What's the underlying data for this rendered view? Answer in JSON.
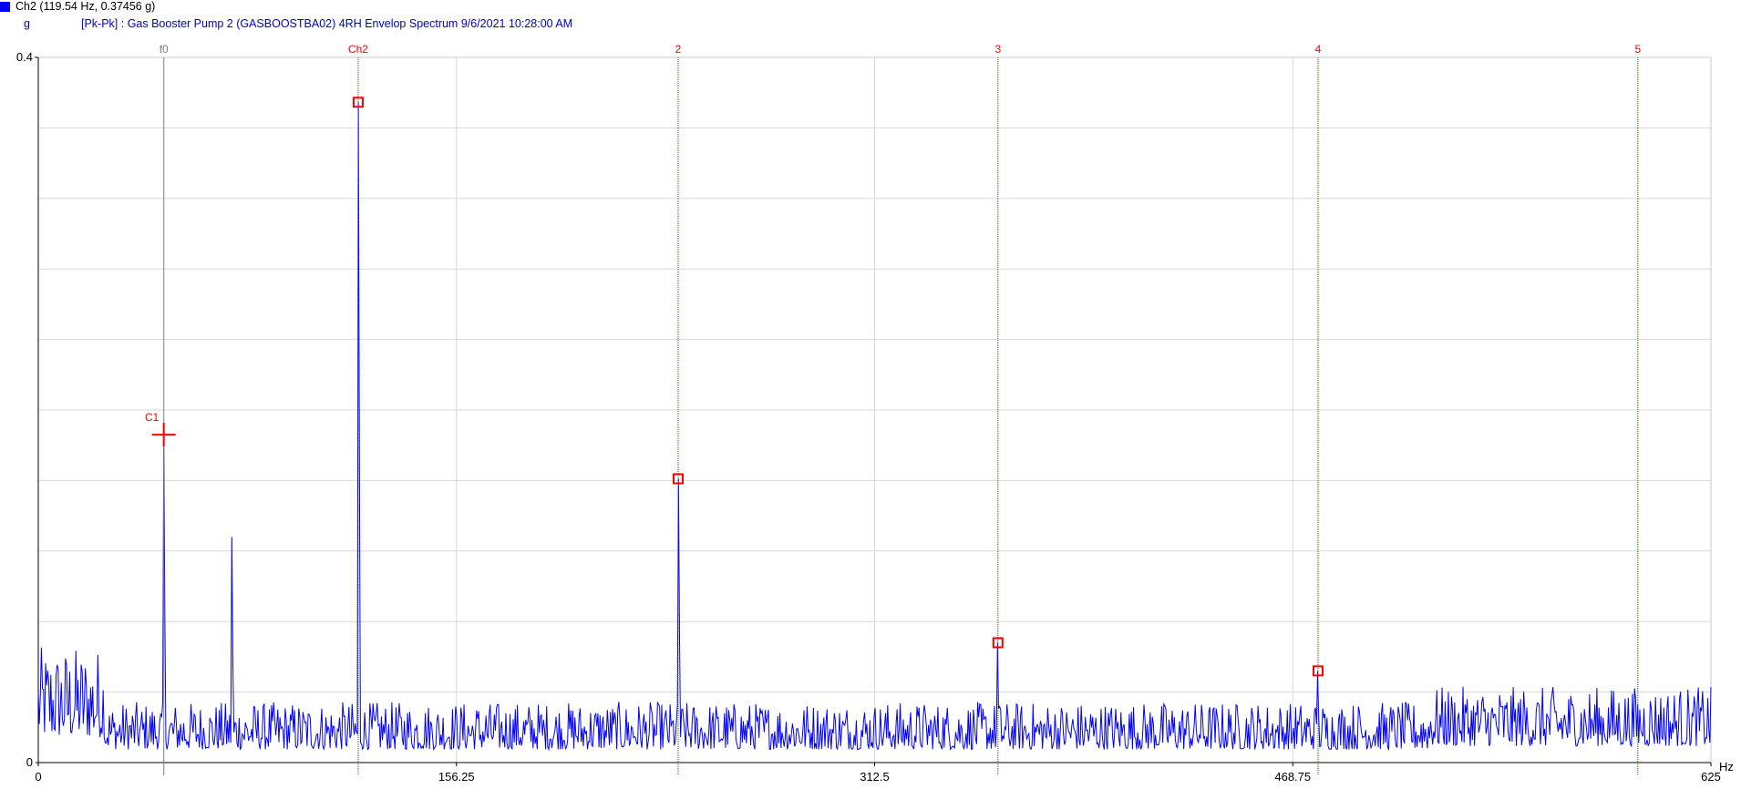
{
  "legend": {
    "channel_label": "Ch2 (119.54 Hz, 0.37456 g)",
    "unit": "g",
    "description": "[Pk-Pk] : Gas Booster Pump 2 (GASBOOSTBA02) 4RH Envelop Spectrum 9/6/2021 10:28:00 AM",
    "swatch_color": "#0000ff"
  },
  "chart_data": {
    "type": "line",
    "title": "",
    "xlabel": "Hz",
    "ylabel": "g",
    "xlim": [
      0,
      625
    ],
    "ylim": [
      0,
      0.4
    ],
    "x_ticks": [
      0,
      156.25,
      312.5,
      468.75,
      625
    ],
    "x_tick_labels": [
      "0",
      "156.25",
      "312.5",
      "468.75",
      "625"
    ],
    "y_ticks": [
      0,
      0.4
    ],
    "y_tick_labels": [
      "0",
      "0.4"
    ],
    "grid": true,
    "series_color": "#0000ff",
    "noise_floor_g": 0.03,
    "peaks": [
      {
        "x": 46.9,
        "y": 0.186
      },
      {
        "x": 72.3,
        "y": 0.128
      },
      {
        "x": 119.54,
        "y": 0.37456
      },
      {
        "x": 239.1,
        "y": 0.161
      },
      {
        "x": 358.6,
        "y": 0.068
      },
      {
        "x": 478.2,
        "y": 0.052
      }
    ],
    "cursor": {
      "label": "C1",
      "x": 46.9,
      "y": 0.186,
      "color": "#ff0000"
    },
    "reference_line": {
      "label": "f0",
      "x": 46.9,
      "color": "#808080"
    },
    "harmonic_markers": [
      {
        "label": "Ch2",
        "x": 119.54,
        "y": 0.37456
      },
      {
        "label": "2",
        "x": 239.1,
        "y": 0.161
      },
      {
        "label": "3",
        "x": 358.6,
        "y": 0.068
      },
      {
        "label": "4",
        "x": 478.2,
        "y": 0.052
      },
      {
        "label": "5",
        "x": 597.7,
        "y": null
      }
    ],
    "marker_color": "#ff0000"
  }
}
